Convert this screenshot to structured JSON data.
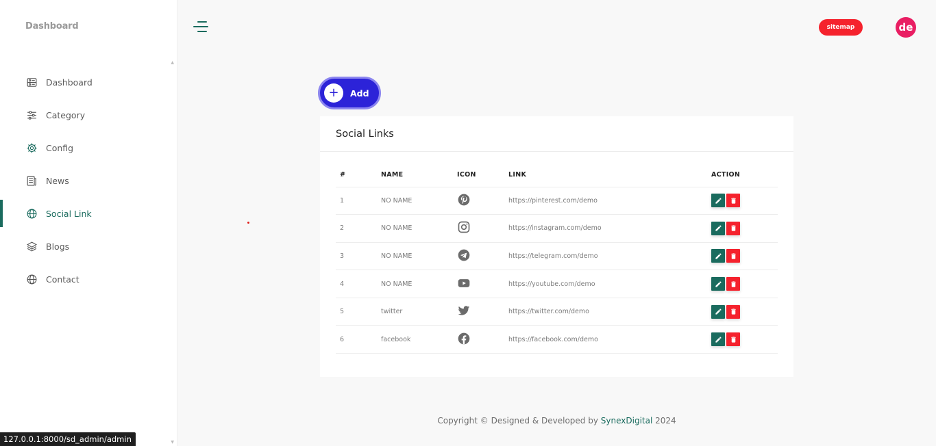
{
  "app": {
    "brand": "Dashboard"
  },
  "sidebar": {
    "items": [
      {
        "label": "Dashboard",
        "icon": "dashboard-icon",
        "active": false
      },
      {
        "label": "Category",
        "icon": "sliders-icon",
        "active": false
      },
      {
        "label": "Config",
        "icon": "gear-icon",
        "active": false
      },
      {
        "label": "News",
        "icon": "newspaper-icon",
        "active": false
      },
      {
        "label": "Social Link",
        "icon": "globe-icon",
        "active": true
      },
      {
        "label": "Blogs",
        "icon": "layers-icon",
        "active": false
      },
      {
        "label": "Contact",
        "icon": "globe-icon",
        "active": false
      }
    ]
  },
  "header": {
    "sitemap_label": "sitemap",
    "avatar_initials": "de"
  },
  "toolbar": {
    "add_label": "Add",
    "add_icon": "plus-icon"
  },
  "card": {
    "title": "Social Links",
    "columns": [
      "#",
      "NAME",
      "ICON",
      "LINK",
      "ACTION"
    ],
    "rows": [
      {
        "num": "1",
        "name": "NO NAME",
        "icon": "pinterest-icon",
        "link": "https://pinterest.com/demo"
      },
      {
        "num": "2",
        "name": "NO NAME",
        "icon": "instagram-icon",
        "link": "https://instagram.com/demo"
      },
      {
        "num": "3",
        "name": "NO NAME",
        "icon": "telegram-icon",
        "link": "https://telegram.com/demo"
      },
      {
        "num": "4",
        "name": "NO NAME",
        "icon": "youtube-icon",
        "link": "https://youtube.com/demo"
      },
      {
        "num": "5",
        "name": "twitter",
        "icon": "twitter-icon",
        "link": "https://twitter.com/demo"
      },
      {
        "num": "6",
        "name": "facebook",
        "icon": "facebook-icon",
        "link": "https://facebook.com/demo"
      }
    ]
  },
  "footer": {
    "prefix": "Copyright © Designed & Developed by ",
    "brand": "SynexDigital",
    "suffix": " 2024"
  },
  "statusbar": {
    "url": "127.0.0.1:8000/sd_admin/admin"
  },
  "colors": {
    "accent": "#1a6b5e",
    "danger": "#f5222d",
    "primary": "#2c23d8",
    "avatar": "#e91e63"
  }
}
